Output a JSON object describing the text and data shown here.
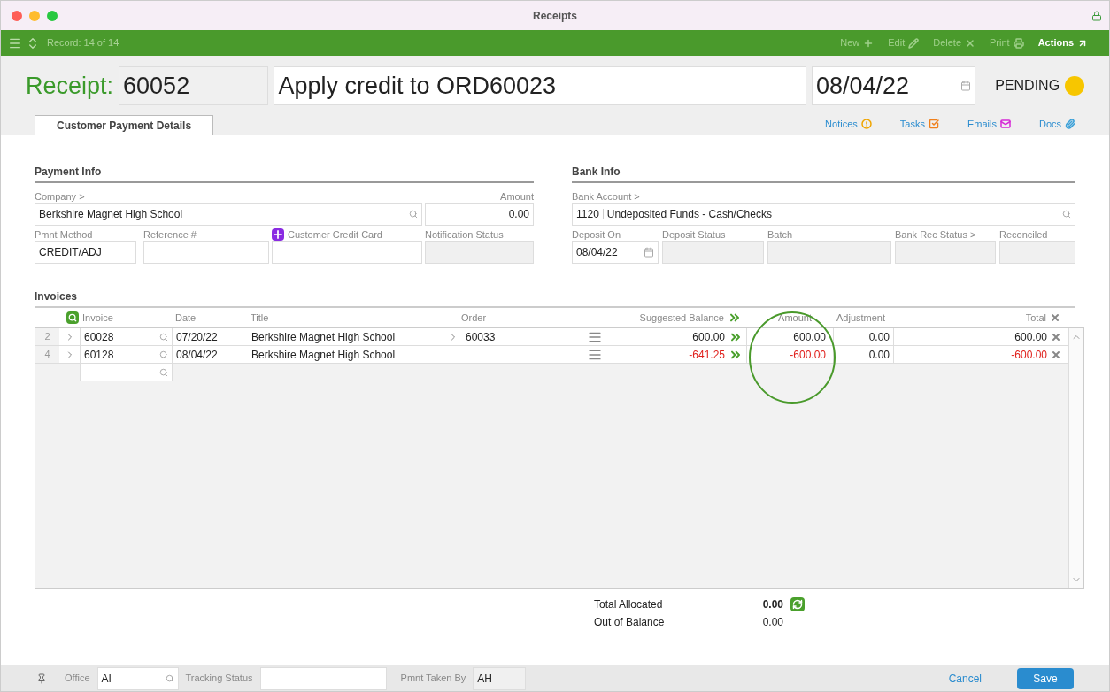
{
  "window": {
    "title": "Receipts"
  },
  "toolbar": {
    "record": "Record: 14 of 14",
    "actions": [
      {
        "label": "New",
        "kind": "plus",
        "disabled": true
      },
      {
        "label": "Edit",
        "kind": "pencil",
        "disabled": true
      },
      {
        "label": "Delete",
        "kind": "x",
        "disabled": true
      },
      {
        "label": "Print",
        "kind": "printer",
        "disabled": true
      },
      {
        "label": "Actions",
        "kind": "arrow",
        "disabled": false
      }
    ]
  },
  "header": {
    "label": "Receipt:",
    "number": "60052",
    "description": "Apply credit to ORD60023",
    "date": "08/04/22",
    "status": {
      "label": "PENDING",
      "color": "#f7c600"
    }
  },
  "tabs": [
    {
      "label": "Customer Payment Details",
      "selected": true
    }
  ],
  "links": [
    {
      "label": "Notices",
      "kind": "notice"
    },
    {
      "label": "Tasks",
      "kind": "task"
    },
    {
      "label": "Emails",
      "kind": "email"
    },
    {
      "label": "Docs",
      "kind": "doc"
    }
  ],
  "payment_info": {
    "title": "Payment Info",
    "company_label": "Company >",
    "company": "Berkshire Magnet High School",
    "amount_label": "Amount",
    "amount": "0.00",
    "method_label": "Pmnt Method",
    "method": "CREDIT/ADJ",
    "reference_label": "Reference #",
    "card_label": "Customer Credit Card",
    "notification_label": "Notification Status"
  },
  "bank_info": {
    "title": "Bank Info",
    "account_label": "Bank Account >",
    "account_number": "1120",
    "account_name": "Undeposited Funds - Cash/Checks",
    "deposit_on_label": "Deposit On",
    "deposit_on": "08/04/22",
    "deposit_status_label": "Deposit Status",
    "batch_label": "Batch",
    "bank_rec_label": "Bank Rec Status >",
    "reconciled_label": "Reconciled"
  },
  "invoices": {
    "title": "Invoices",
    "columns": [
      "Invoice",
      "Date",
      "Title",
      "Order",
      "Suggested Balance",
      "Amount",
      "Adjustment",
      "Total"
    ],
    "rows": [
      {
        "row": "2",
        "invoice": "60028",
        "date": "07/20/22",
        "title": "Berkshire Magnet High School",
        "order": "60033",
        "suggested_balance": "600.00",
        "amount": "600.00",
        "adjustment": "0.00",
        "total": "600.00",
        "negative": false
      },
      {
        "row": "4",
        "invoice": "60128",
        "date": "08/04/22",
        "title": "Berkshire Magnet High School",
        "suggested_balance": "-641.25",
        "amount": "-600.00",
        "adjustment": "0.00",
        "total": "-600.00",
        "negative": true
      }
    ]
  },
  "totals": [
    {
      "label": "Total Allocated",
      "value": "0.00",
      "bold": true
    },
    {
      "label": "Out of Balance",
      "value": "0.00",
      "bold": false
    }
  ],
  "footer": {
    "office_label": "Office",
    "office": "AI",
    "tracking_label": "Tracking Status",
    "taken_by_label": "Pmnt Taken By",
    "taken_by": "AH",
    "cancel": "Cancel",
    "save": "Save"
  }
}
